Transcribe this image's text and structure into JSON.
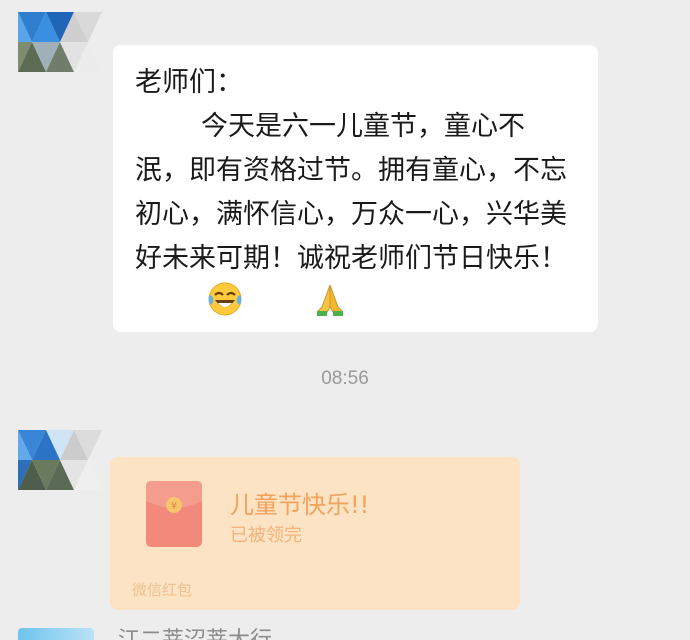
{
  "chat": {
    "message": {
      "greeting": "老师们：",
      "body": "今天是六一儿童节，童心不泯，即有资格过节。拥有童心，不忘初心，满怀信心，万众一心，兴华美好未来可期！诚祝老师们节日快乐！",
      "emojis": [
        "tears-of-joy-emoji",
        "folded-hands-emoji"
      ]
    },
    "timestamp": "08:56",
    "red_packet": {
      "title": "儿童节快乐!!",
      "status": "已被领完",
      "footer": "微信红包",
      "colors": {
        "card": "#fbe3c4",
        "envelope": "#f2897b",
        "title": "#f2a25b"
      }
    },
    "next_message": {
      "preview": "江二莘沼莘大行"
    }
  }
}
